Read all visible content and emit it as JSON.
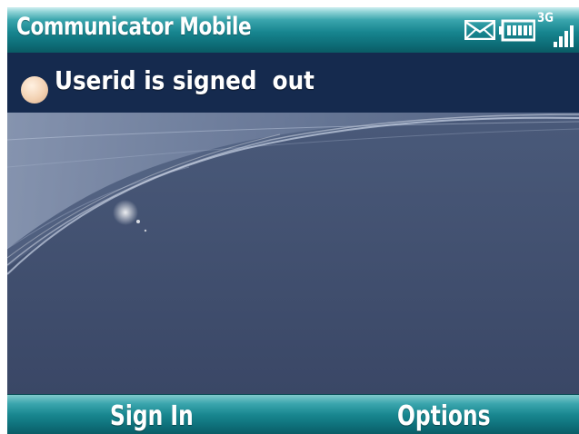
{
  "titlebar": {
    "title": "Communicator Mobile",
    "network_type": "3G",
    "icons": [
      "envelope-icon",
      "battery-icon",
      "signal-icon"
    ]
  },
  "presence": {
    "status_text": "Userid is signed  out",
    "status_color": "#f3d2b3",
    "icon": "presence-dot-icon"
  },
  "softkeys": {
    "left_label": "Sign In",
    "right_label": "Options"
  },
  "colors": {
    "title_bar": "#17858f",
    "presence_bar": "#152a4e",
    "wallpaper": "#3d4b69"
  }
}
